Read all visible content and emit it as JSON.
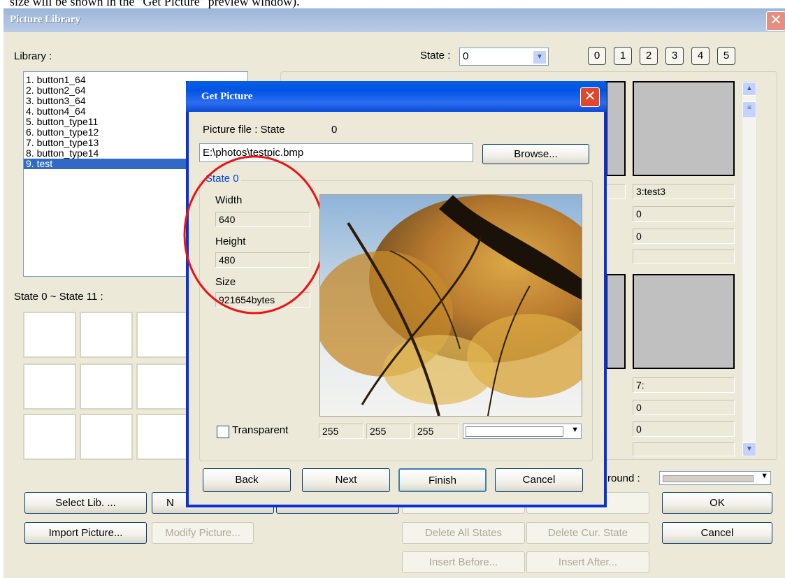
{
  "caption": "size will be shown in the \"Get Picture\" preview window).",
  "main_window": {
    "title": "Picture Library",
    "library_label": "Library :",
    "state_label": "State :",
    "state_value": "0",
    "state_buttons": [
      "0",
      "1",
      "2",
      "3",
      "4",
      "5"
    ],
    "library_items": [
      {
        "label": "1. button1_64",
        "selected": false
      },
      {
        "label": "2. button2_64",
        "selected": false
      },
      {
        "label": "3. button3_64",
        "selected": false
      },
      {
        "label": "4. button4_64",
        "selected": false
      },
      {
        "label": "5. button_type11",
        "selected": false
      },
      {
        "label": "6. button_type12",
        "selected": false
      },
      {
        "label": "7. button_type13",
        "selected": false
      },
      {
        "label": "8. button_type14",
        "selected": false
      },
      {
        "label": "9. test",
        "selected": true
      }
    ],
    "state_range_label": "State 0 ~ State 11 :",
    "preview_fields": {
      "top": [
        "3:test3",
        "0",
        "0",
        ""
      ],
      "bottom": [
        "7:",
        "0",
        "0",
        ""
      ]
    },
    "background_label": "round :",
    "buttons": {
      "select_lib": "Select Lib. ...",
      "new_partial": "N",
      "import_picture": "Import Picture...",
      "modify_picture": "Modify Picture...",
      "delete_all_states": "Delete All States",
      "delete_cur_state": "Delete Cur. State",
      "insert_before": "Insert Before...",
      "insert_after": "Insert After...",
      "ok": "OK",
      "cancel": "Cancel"
    }
  },
  "dialog": {
    "title": "Get Picture",
    "file_label": "Picture file : State",
    "file_state": "0",
    "file_path": "E:\\photos\\testpic.bmp",
    "browse": "Browse...",
    "group_label": "State 0",
    "width_label": "Width",
    "width_value": "640",
    "height_label": "Height",
    "height_value": "480",
    "size_label": "Size",
    "size_value": "921654bytes",
    "transparent_label": "Transparent",
    "rgb": [
      "255",
      "255",
      "255"
    ],
    "buttons": {
      "back": "Back",
      "next": "Next",
      "finish": "Finish",
      "cancel": "Cancel"
    }
  }
}
